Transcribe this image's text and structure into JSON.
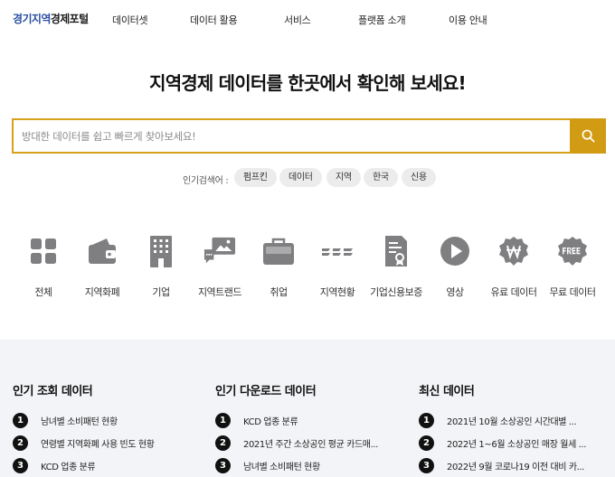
{
  "header": {
    "logo_part1": "경기지역",
    "logo_part2": "경제포털",
    "nav": [
      "데이터셋",
      "데이터 활용",
      "서비스",
      "플랫폼 소개",
      "이용 안내"
    ]
  },
  "hero": {
    "title": "지역경제 데이터를 한곳에서 확인해 보세요!",
    "search_placeholder": "방대한 데이터를 쉽고 빠르게 찾아보세요!",
    "search_icon": "search-icon",
    "popular_label": "인기검색어 :",
    "popular_keywords": [
      "펌프킨",
      "데이터",
      "지역",
      "한국",
      "신용"
    ]
  },
  "categories": [
    {
      "label": "전체",
      "icon": "grid-icon"
    },
    {
      "label": "지역화폐",
      "icon": "wallet-icon"
    },
    {
      "label": "기업",
      "icon": "building-icon"
    },
    {
      "label": "지역트랜드",
      "icon": "image-chat-icon"
    },
    {
      "label": "취업",
      "icon": "briefcase-icon"
    },
    {
      "label": "지역현황",
      "icon": "dash-lines-icon"
    },
    {
      "label": "기업신용보증",
      "icon": "certificate-icon"
    },
    {
      "label": "영상",
      "icon": "play-icon"
    },
    {
      "label": "유료 데이터",
      "icon": "won-badge-icon"
    },
    {
      "label": "무료 데이터",
      "icon": "free-badge-icon"
    }
  ],
  "icon_color": "#7f7f82",
  "accent_color": "#d29b14",
  "lists": [
    {
      "title": "인기 조회 데이터",
      "items": [
        {
          "rank": "1",
          "text": "남녀별 소비패턴 현황"
        },
        {
          "rank": "2",
          "text": "연령별 지역화폐 사용 빈도 현황"
        },
        {
          "rank": "3",
          "text": "KCD 업종 분류"
        }
      ]
    },
    {
      "title": "인기 다운로드 데이터",
      "items": [
        {
          "rank": "1",
          "text": "KCD 업종 분류"
        },
        {
          "rank": "2",
          "text": "2021년 주간 소상공인 평균 카드매..."
        },
        {
          "rank": "3",
          "text": "남녀별 소비패턴 현황"
        }
      ]
    },
    {
      "title": "최신 데이터",
      "items": [
        {
          "rank": "1",
          "text": "2021년 10월 소상공인 시간대별 ..."
        },
        {
          "rank": "2",
          "text": "2022년 1~6월 소상공인 매장 월세 ..."
        },
        {
          "rank": "3",
          "text": "2022년 9월 코로나19 이전 대비 카..."
        }
      ]
    }
  ]
}
